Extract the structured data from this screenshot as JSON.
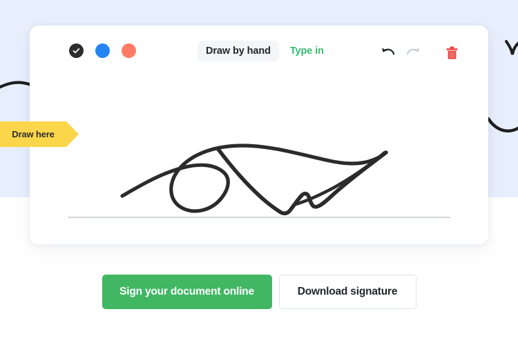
{
  "theme": {
    "band_color": "#e7eefc",
    "card_color": "#ffffff",
    "accent_green": "#41b763",
    "tab_green": "#35bb6f",
    "trash_red": "#e8423c",
    "pointer_yellow": "#fbd64a",
    "ink_color": "#2b2b2b",
    "signature_line": "#d3d7dc"
  },
  "toolbar": {
    "swatches": [
      {
        "name": "black",
        "color": "#2d2d2d",
        "selected": true
      },
      {
        "name": "blue",
        "color": "#2684f5",
        "selected": false
      },
      {
        "name": "coral",
        "color": "#ff7b66",
        "selected": false
      }
    ],
    "tabs": [
      {
        "id": "draw-by-hand",
        "label": "Draw by hand",
        "active": true
      },
      {
        "id": "type-in",
        "label": "Type in",
        "active": false
      }
    ],
    "actions": [
      {
        "id": "undo",
        "icon": "undo-icon",
        "enabled": true
      },
      {
        "id": "redo",
        "icon": "redo-icon",
        "enabled": false
      },
      {
        "id": "clear",
        "icon": "trash-icon",
        "enabled": true
      }
    ]
  },
  "pointer": {
    "label": "Draw here"
  },
  "canvas": {
    "has_signature": true,
    "stroke_color": "#2b2b2b"
  },
  "footer": {
    "primary_label": "Sign your document online",
    "secondary_label": "Download signature"
  }
}
